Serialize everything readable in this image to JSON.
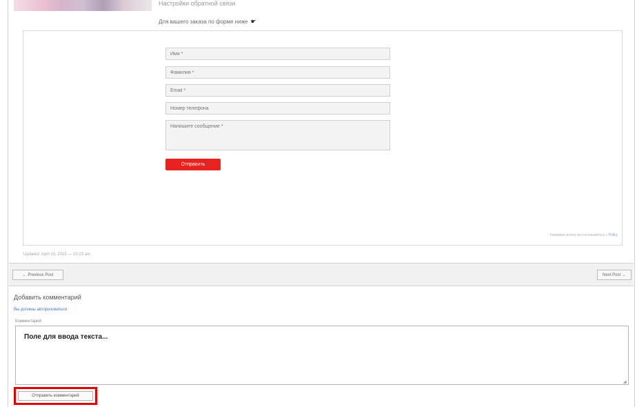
{
  "post": {
    "caption": "Настройки обратной связи",
    "form_intro": "Для вашего заказа по форме ниже",
    "form_intro_icon": "hand-pointer-icon",
    "date": "Updated: April 10, 2015 — 10:23 am"
  },
  "form": {
    "name_placeholder": "Имя *",
    "surname_placeholder": "Фамилия *",
    "email_placeholder": "Email *",
    "phone_placeholder": "Номер телефона",
    "message_placeholder": "Напишите сообщение *",
    "submit_label": "Отправить",
    "privacy_text": "Нажимая кнопку вы соглашаетесь с ",
    "privacy_link": "Policy"
  },
  "nav": {
    "prev_label": "← Previous Post",
    "next_label": "Next Post →"
  },
  "comments": {
    "title": "Добавить комментарий",
    "login_link": "Вы должны авторизоваться",
    "field_label": "Комментарий",
    "placeholder": "Поле для ввода текста...",
    "submit_label": "Отправить комментарий"
  },
  "colors": {
    "accent_red": "#e8221e",
    "highlight_red": "#e30000",
    "link_blue": "#4a74c9"
  }
}
